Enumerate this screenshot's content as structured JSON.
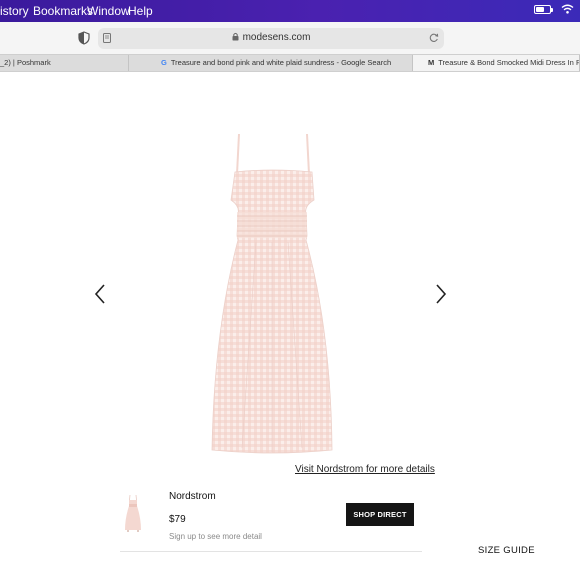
{
  "menubar": {
    "items": [
      {
        "label": "istory"
      },
      {
        "label": "Bookmarks"
      },
      {
        "label": "Window"
      },
      {
        "label": "Help"
      }
    ],
    "battery_level": 0.6
  },
  "toolbar": {
    "url": "modesens.com"
  },
  "tabs": [
    {
      "label": "_2) | Poshmark",
      "favicon": "",
      "active": false
    },
    {
      "label": "Treasure and bond pink and white plaid sundress - Google Search",
      "favicon": "G",
      "active": false
    },
    {
      "label": "Treasure & Bond Smocked Midi Dress In Pink",
      "favicon": "M",
      "active": true
    }
  ],
  "product": {
    "visit_link": "Visit Nordstrom for more details",
    "retailer": "Nordstrom",
    "price": "$79",
    "signup_text": "Sign up to see more detail",
    "shop_button": "SHOP DIRECT",
    "size_guide": "SIZE GUIDE"
  },
  "colors": {
    "menubar": "#4a21b0",
    "dress_pink": "#f6dcd6",
    "button_dark": "#151515"
  }
}
